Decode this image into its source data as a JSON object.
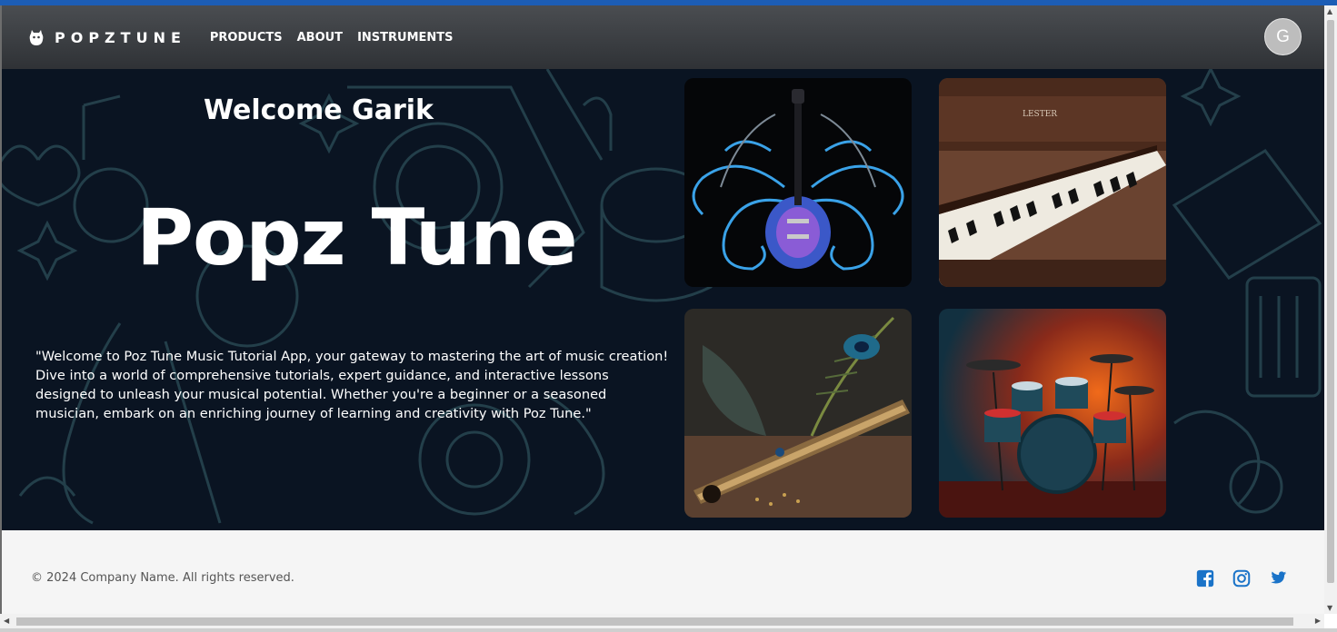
{
  "navbar": {
    "brand": "POPZTUNE",
    "links": [
      "PRODUCTS",
      "ABOUT",
      "INSTRUMENTS"
    ],
    "avatar_initial": "G"
  },
  "hero": {
    "welcome": "Welcome Garik",
    "title": "Popz Tune",
    "description": "\"Welcome to Poz Tune Music Tutorial App, your gateway to mastering the art of music creation! Dive into a world of comprehensive tutorials, expert guidance, and interactive lessons designed to unleash your musical potential. Whether you're a beginner or a seasoned musician, embark on an enriching journey of learning and creativity with Poz Tune.\"",
    "piano_brand": "LESTER",
    "images": [
      "electric-guitar",
      "piano",
      "flute-with-peacock-feather",
      "drum-kit"
    ]
  },
  "footer": {
    "copyright": "© 2024 Company Name. All rights reserved.",
    "socials": [
      "facebook-icon",
      "instagram-icon",
      "twitter-icon"
    ],
    "icon_color": "#1a73c8"
  },
  "colors": {
    "accent_strip": "#1c5db5",
    "navbar": "#3a3d41",
    "hero_background": "#0a1422"
  }
}
